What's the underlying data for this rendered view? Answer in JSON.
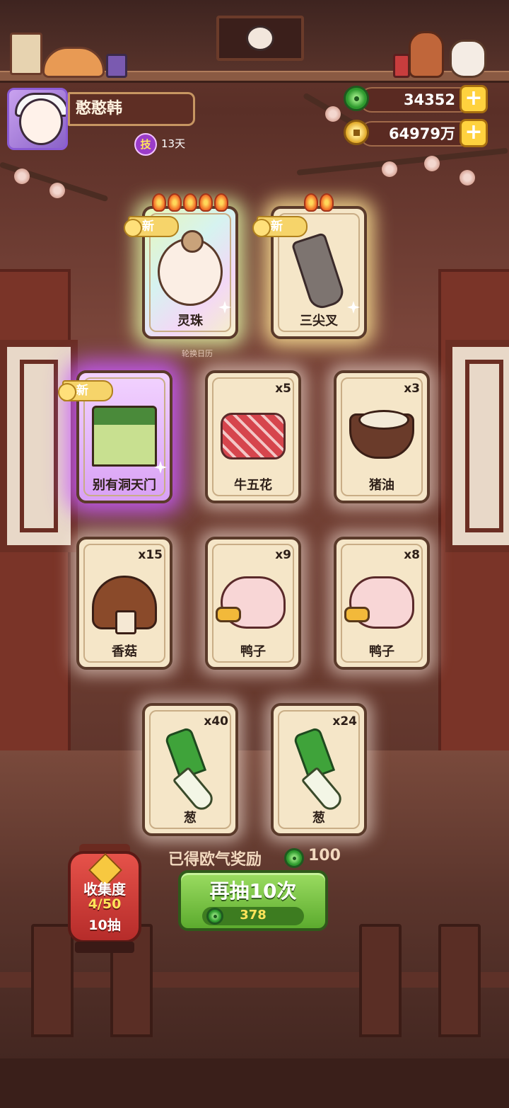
{
  "player": {
    "name": "憨憨韩",
    "skill_badge": "技",
    "days": "13天"
  },
  "currency": {
    "jade": "34352",
    "coins": "64979万",
    "plus": "+"
  },
  "calendar_label": "轮换日历",
  "cards": [
    {
      "label": "灵珠",
      "qty": "",
      "new": "新",
      "flames": 5
    },
    {
      "label": "三尖叉",
      "qty": "",
      "new": "新",
      "flames": 2
    },
    {
      "label": "别有洞天门",
      "qty": "",
      "new": "新",
      "flames": 0
    },
    {
      "label": "牛五花",
      "qty": "x5"
    },
    {
      "label": "猪油",
      "qty": "x3"
    },
    {
      "label": "香菇",
      "qty": "x15"
    },
    {
      "label": "鸭子",
      "qty": "x9"
    },
    {
      "label": "鸭子",
      "qty": "x8"
    },
    {
      "label": "葱",
      "qty": "x40"
    },
    {
      "label": "葱",
      "qty": "x24"
    }
  ],
  "reward": {
    "text": "已得欧气奖励",
    "amount": "100"
  },
  "draw_button": {
    "label": "再抽10次",
    "cost": "378"
  },
  "collection": {
    "title": "收集度",
    "progress": "4/50",
    "draws": "10抽"
  }
}
